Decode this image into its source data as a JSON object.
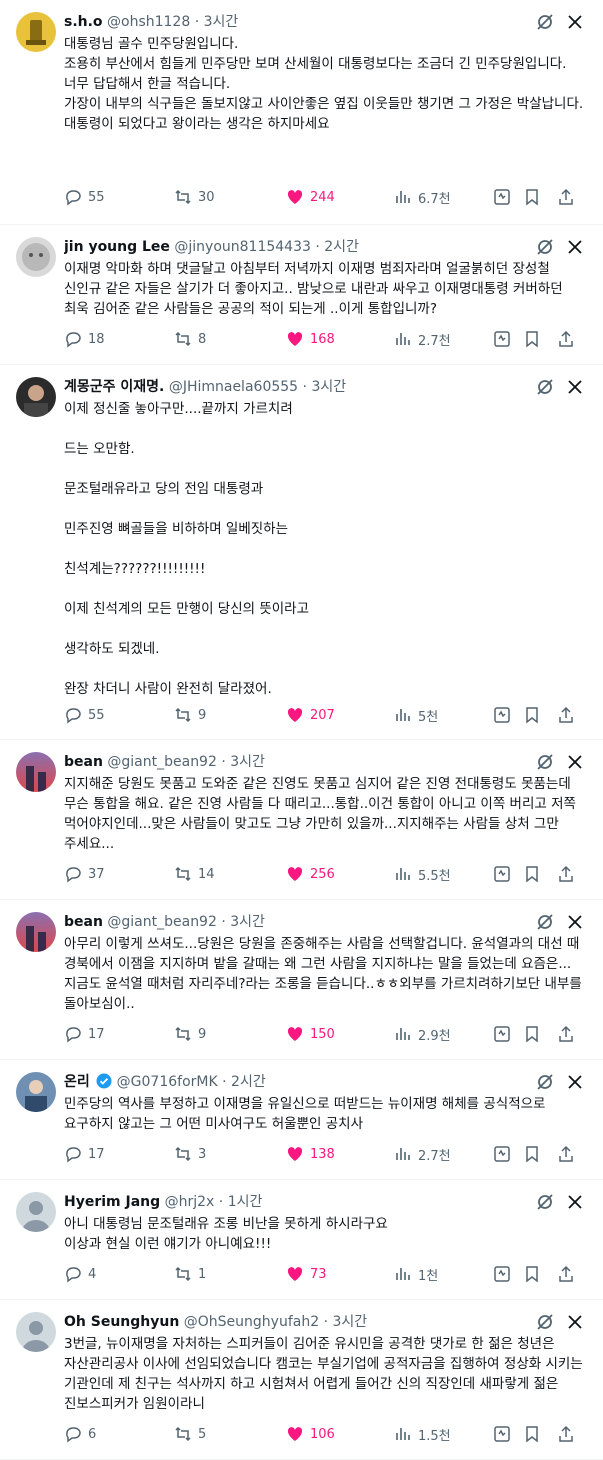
{
  "colors": {
    "like": "#f91880",
    "muted": "#536471",
    "verified": "#1d9bf0",
    "divider": "#eff3f4"
  },
  "icons": {
    "reply": "reply-icon",
    "retweet": "retweet-icon",
    "like": "heart-icon",
    "views": "views-icon",
    "grok": "grok-icon",
    "bookmark": "bookmark-icon",
    "share": "share-icon",
    "more": "more-icon"
  },
  "tweets": [
    {
      "name": "s.h.o",
      "handle": "@ohsh1128",
      "time": "3시간",
      "body": "대통령님 골수 민주당원입니다.\n조용히 부산에서 힘들게 민주당만 보며 산세월이 대통령보다는 조금더 긴 민주당원입니다.\n너무 답답해서 한글 적습니다.\n가장이 내부의 식구들은 돌보지않고 사이안좋은 옆집 이웃들만 챙기면 그 가정은 박살납니다.\n대통령이 되었다고 왕이라는 생각은 하지마세요",
      "replies": "55",
      "retweets": "30",
      "likes": "244",
      "views": "6.7천"
    },
    {
      "name": "jin young Lee",
      "handle": "@jinyoun81154433",
      "time": "2시간",
      "body": "이재명 악마화 하며 댓글달고 아침부터 저녁까지 이재명 범죄자라며 얼굴붉히던 장성철 신인규 같은 자들은 살기가 더 좋아지고.. 밤낮으로 내란과 싸우고 이재명대통령 커버하던 최욱 김어준 같은 사람들은 공공의 적이 되는게 ..이게 통합입니까?",
      "replies": "18",
      "retweets": "8",
      "likes": "168",
      "views": "2.7천"
    },
    {
      "name": "계몽군주 이재명.",
      "handle": "@JHimnaela60555",
      "time": "3시간",
      "body": "이제 정신줄 놓아구만....끝까지 가르치려\n\n드는 오만함.\n\n문조털래유라고 당의 전임 대통령과\n\n민주진영 뼈골들을 비하하며 일베짓하는\n\n친석계는??????!!!!!!!!!\n\n이제 친석계의 모든 만행이 당신의 뜻이라고\n\n생각하도 되겠네.\n\n완장 차더니 사람이 완전히 달라졌어.",
      "replies": "55",
      "retweets": "9",
      "likes": "207",
      "views": "5천"
    },
    {
      "name": "bean",
      "handle": "@giant_bean92",
      "time": "3시간",
      "body": "지지해준 당원도 못품고 도와준 같은 진영도 못품고 심지어 같은 진영 전대통령도 못품는데 무슨 통합을 해요. 같은 진영 사람들 다 때리고...통합..이건 통합이 아니고 이쪽 버리고 저쪽 먹어야지인데...맞은 사람들이 맞고도 그냥 가만히 있을까...지지해주는 사람들 상처 그만 주세요...",
      "replies": "37",
      "retweets": "14",
      "likes": "256",
      "views": "5.5천"
    },
    {
      "name": "bean",
      "handle": "@giant_bean92",
      "time": "3시간",
      "body": "아무리 이렇게 쓰셔도...당원은 당원을 존중해주는 사람을 선택할겁니다. 윤석열과의 대선 때 경북에서 이잼을 지지하며 밭을 갈때는 왜 그런 사람을 지지하냐는 말을 들었는데 요즘은...지금도 윤석열 때처럼 자리주네?라는 조롱을 듣습니다..ㅎㅎ외부를 가르치려하기보단 내부를 돌아보심이..",
      "replies": "17",
      "retweets": "9",
      "likes": "150",
      "views": "2.9천"
    },
    {
      "name": "온리",
      "handle": "@G0716forMK",
      "time": "2시간",
      "body": "민주당의 역사를 부정하고 이재명을 유일신으로 떠받드는 뉴이재명 해체를 공식적으로 요구하지 않고는 그 어떤 미사여구도 허울뿐인 공치사",
      "replies": "17",
      "retweets": "3",
      "likes": "138",
      "views": "2.7천"
    },
    {
      "name": "Hyerim Jang",
      "handle": "@hrj2x",
      "time": "1시간",
      "body": "아니 대통령님 문조털래유 조롱 비난을 못하게 하시라구요\n이상과 현실 이런 얘기가 아니예요!!!",
      "replies": "4",
      "retweets": "1",
      "likes": "73",
      "views": "1천"
    },
    {
      "name": "Oh Seunghyun",
      "handle": "@OhSeunghyufah2",
      "time": "3시간",
      "body": "3번글, 뉴이재명을 자처하는 스피커들이 김어준 유시민을 공격한 댓가로 한 젊은 청년은 자산관리공사 이사에 선임되었습니다 캠코는 부실기업에 공적자금을 집행하여 정상화 시키는 기관인데 제 친구는 석사까지 하고 시험쳐서 어렵게 들어간 신의 직장인데 새파랗게 젊은 진보스피커가 임원이라니",
      "replies": "6",
      "retweets": "5",
      "likes": "106",
      "views": "1.5천"
    }
  ]
}
